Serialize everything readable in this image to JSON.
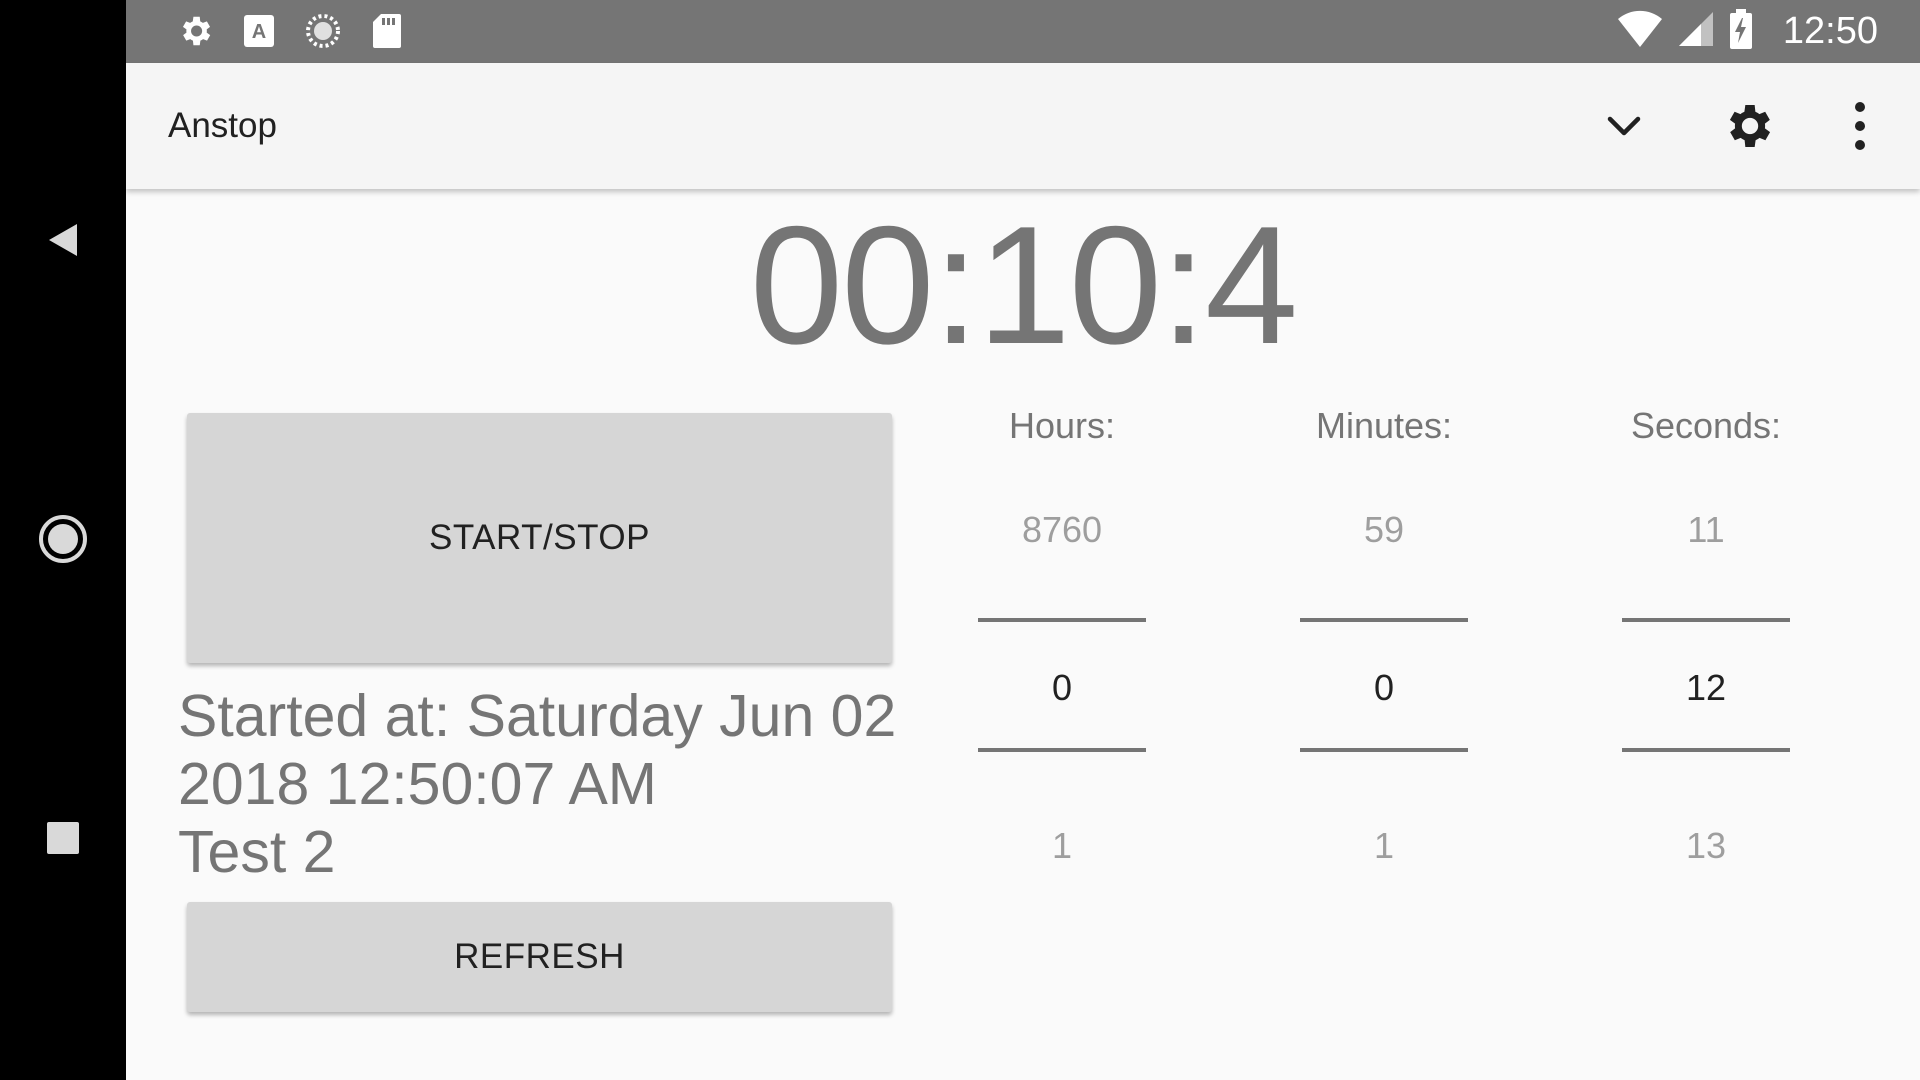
{
  "status_bar": {
    "time": "12:50",
    "left_icons": [
      "gear-icon",
      "text-a-icon",
      "sync-icon",
      "sd-card-icon"
    ],
    "right_icons": [
      "wifi-icon",
      "signal-icon",
      "battery-charging-icon"
    ]
  },
  "nav_bar": {
    "icons": [
      "back-icon",
      "home-icon",
      "recents-icon"
    ]
  },
  "app_bar": {
    "title": "Anstop",
    "actions": [
      "chevron-down-icon",
      "settings-gear-icon",
      "more-vert-icon"
    ]
  },
  "timer": {
    "display": "00:10:4"
  },
  "buttons": {
    "start_stop": "START/STOP",
    "refresh": "REFRESH"
  },
  "started": {
    "line1": "Started at: Saturday Jun 02",
    "line2": "2018 12:50:07 AM",
    "line3": "Test 2"
  },
  "pickers": {
    "hours": {
      "label": "Hours:",
      "prev": "8760",
      "current": "0",
      "next": "1"
    },
    "minutes": {
      "label": "Minutes:",
      "prev": "59",
      "current": "0",
      "next": "1"
    },
    "seconds": {
      "label": "Seconds:",
      "prev": "11",
      "current": "12",
      "next": "13"
    }
  },
  "colors": {
    "status_bar": "#757575",
    "app_bar": "#f5f5f5",
    "button": "#d6d6d6",
    "text_muted": "#757575"
  }
}
